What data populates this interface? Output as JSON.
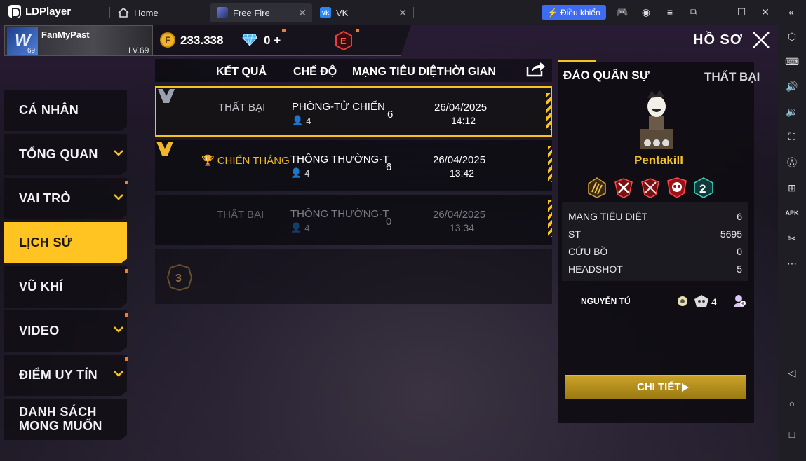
{
  "titlebar": {
    "app_name": "LDPlayer",
    "tabs": [
      {
        "label": "Home",
        "icon": "home-icon"
      },
      {
        "label": "Free Fire",
        "icon": "free-fire-app-icon"
      },
      {
        "label": "VK",
        "icon": "vk-app-icon"
      }
    ],
    "control_button": "Điều khiển",
    "window_icons": [
      "gamepad-icon",
      "account-icon",
      "menu-icon",
      "popout-icon",
      "minimize-icon",
      "maximize-icon",
      "close-icon",
      "collapse-sidebar-icon"
    ]
  },
  "sidebar_icons": [
    "settings-hex-icon",
    "keyboard-icon",
    "volume-up-icon",
    "volume-down-icon",
    "fullscreen-icon",
    "macro-icon",
    "add-window-icon",
    "apk-icon",
    "scissors-icon",
    "more-icon",
    "back-icon",
    "home-circle-icon",
    "recent-apps-icon"
  ],
  "hud": {
    "player_name": "FanMyPast",
    "avatar_level": "69",
    "level": "LV.69",
    "gold": "233.338",
    "diamonds": "0",
    "diamond_plus": "+",
    "title": "HỒ SƠ"
  },
  "menu": [
    {
      "label": "CÁ NHÂN",
      "chevron": false,
      "dot": false
    },
    {
      "label": "TỔNG QUAN",
      "chevron": true,
      "dot": false
    },
    {
      "label": "VAI TRÒ",
      "chevron": true,
      "dot": true
    },
    {
      "label": "LỊCH SỬ",
      "chevron": false,
      "dot": false,
      "active": true
    },
    {
      "label": "VŨ KHÍ",
      "chevron": false,
      "dot": true
    },
    {
      "label": "VIDEO",
      "chevron": true,
      "dot": true
    },
    {
      "label": "ĐIỂM UY TÍN",
      "chevron": true,
      "dot": true
    },
    {
      "label_line1": "DANH SÁCH",
      "label_line2": "MONG MUỐN",
      "chevron": false,
      "dot": false
    }
  ],
  "table": {
    "headers": {
      "result": "KẾT QUẢ",
      "mode": "CHẾ ĐỘ",
      "kills": "MẠNG TIÊU DIỆT",
      "time": "THỜI GIAN"
    },
    "rows": [
      {
        "result": "THẤT BẠI",
        "mode": "PHÒNG-TỬ CHIẾN",
        "players": "4",
        "kills": "6",
        "date": "26/04/2025",
        "time": "14:12"
      },
      {
        "result": "CHIẾN THẮNG",
        "mode": "THÔNG THƯỜNG-T",
        "players": "4",
        "kills": "6",
        "date": "26/04/2025",
        "time": "13:42"
      },
      {
        "result": "THẤT BẠI",
        "mode": "THÔNG THƯỜNG-T",
        "players": "4",
        "kills": "0",
        "date": "26/04/2025",
        "time": "13:34"
      }
    ],
    "streak_count": "3"
  },
  "detail": {
    "map": "ĐẢO QUÂN SỰ",
    "result": "THẤT BẠI",
    "badge_name": "Pentakill",
    "stats": [
      {
        "label": "MẠNG TIÊU DIỆT",
        "value": "6"
      },
      {
        "label": "ST",
        "value": "5695"
      },
      {
        "label": "CỨU BỒ",
        "value": "0"
      },
      {
        "label": "HEADSHOT",
        "value": "5"
      }
    ],
    "player": {
      "name": "NGUYỄN TÚ",
      "kills": "4"
    },
    "button": "CHI TIẾT"
  }
}
